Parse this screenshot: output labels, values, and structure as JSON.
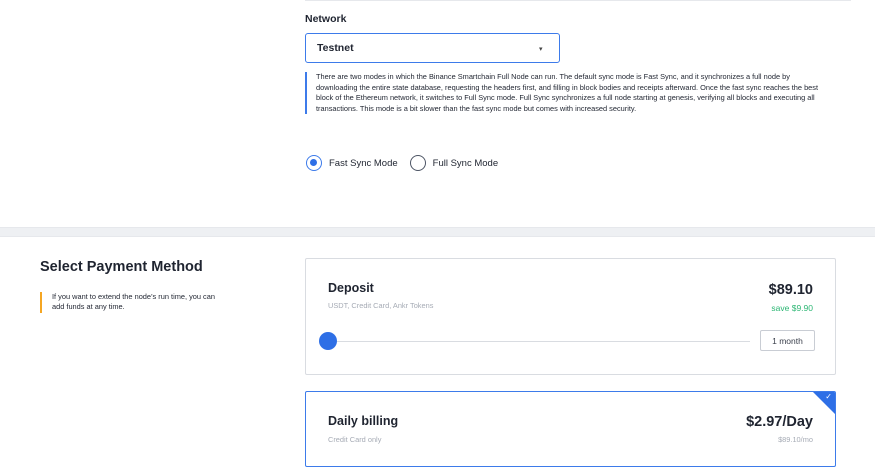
{
  "sync_section": {
    "network_label": "Network",
    "network_select": {
      "value": "Testnet",
      "caret": "▾"
    },
    "note": "There are two modes in which the Binance Smartchain Full Node can run. The default sync mode is Fast Sync, and it synchronizes a full node by downloading the entire state database, requesting the headers first, and filling in block bodies and receipts afterward. Once the fast sync reaches the best block of the Ethereum network, it switches to Full Sync mode. Full Sync synchronizes a full node starting at genesis, verifying all blocks and executing all transactions. This mode is a bit slower than the fast sync mode but comes with increased security.",
    "modes": [
      {
        "label": "Fast Sync Mode",
        "selected": true
      },
      {
        "label": "Full Sync Mode",
        "selected": false
      }
    ]
  },
  "payment_section": {
    "title": "Select Payment Method",
    "note": "If you want to extend the node’s run time, you can add funds at any time.",
    "deposit": {
      "title": "Deposit",
      "subtitle": "USDT, Credit Card, Ankr Tokens",
      "price": "$89.10",
      "save": "save $9.90",
      "slider_value": 0,
      "duration": "1 month"
    },
    "daily": {
      "title": "Daily billing",
      "subtitle": "Credit Card only",
      "price": "$2.97/Day",
      "per_month": "$89.10/mo",
      "selected": true,
      "check": "✓"
    }
  },
  "colors": {
    "accent": "#2e6fe6",
    "warning": "#f5a623",
    "success": "#2bb673"
  }
}
